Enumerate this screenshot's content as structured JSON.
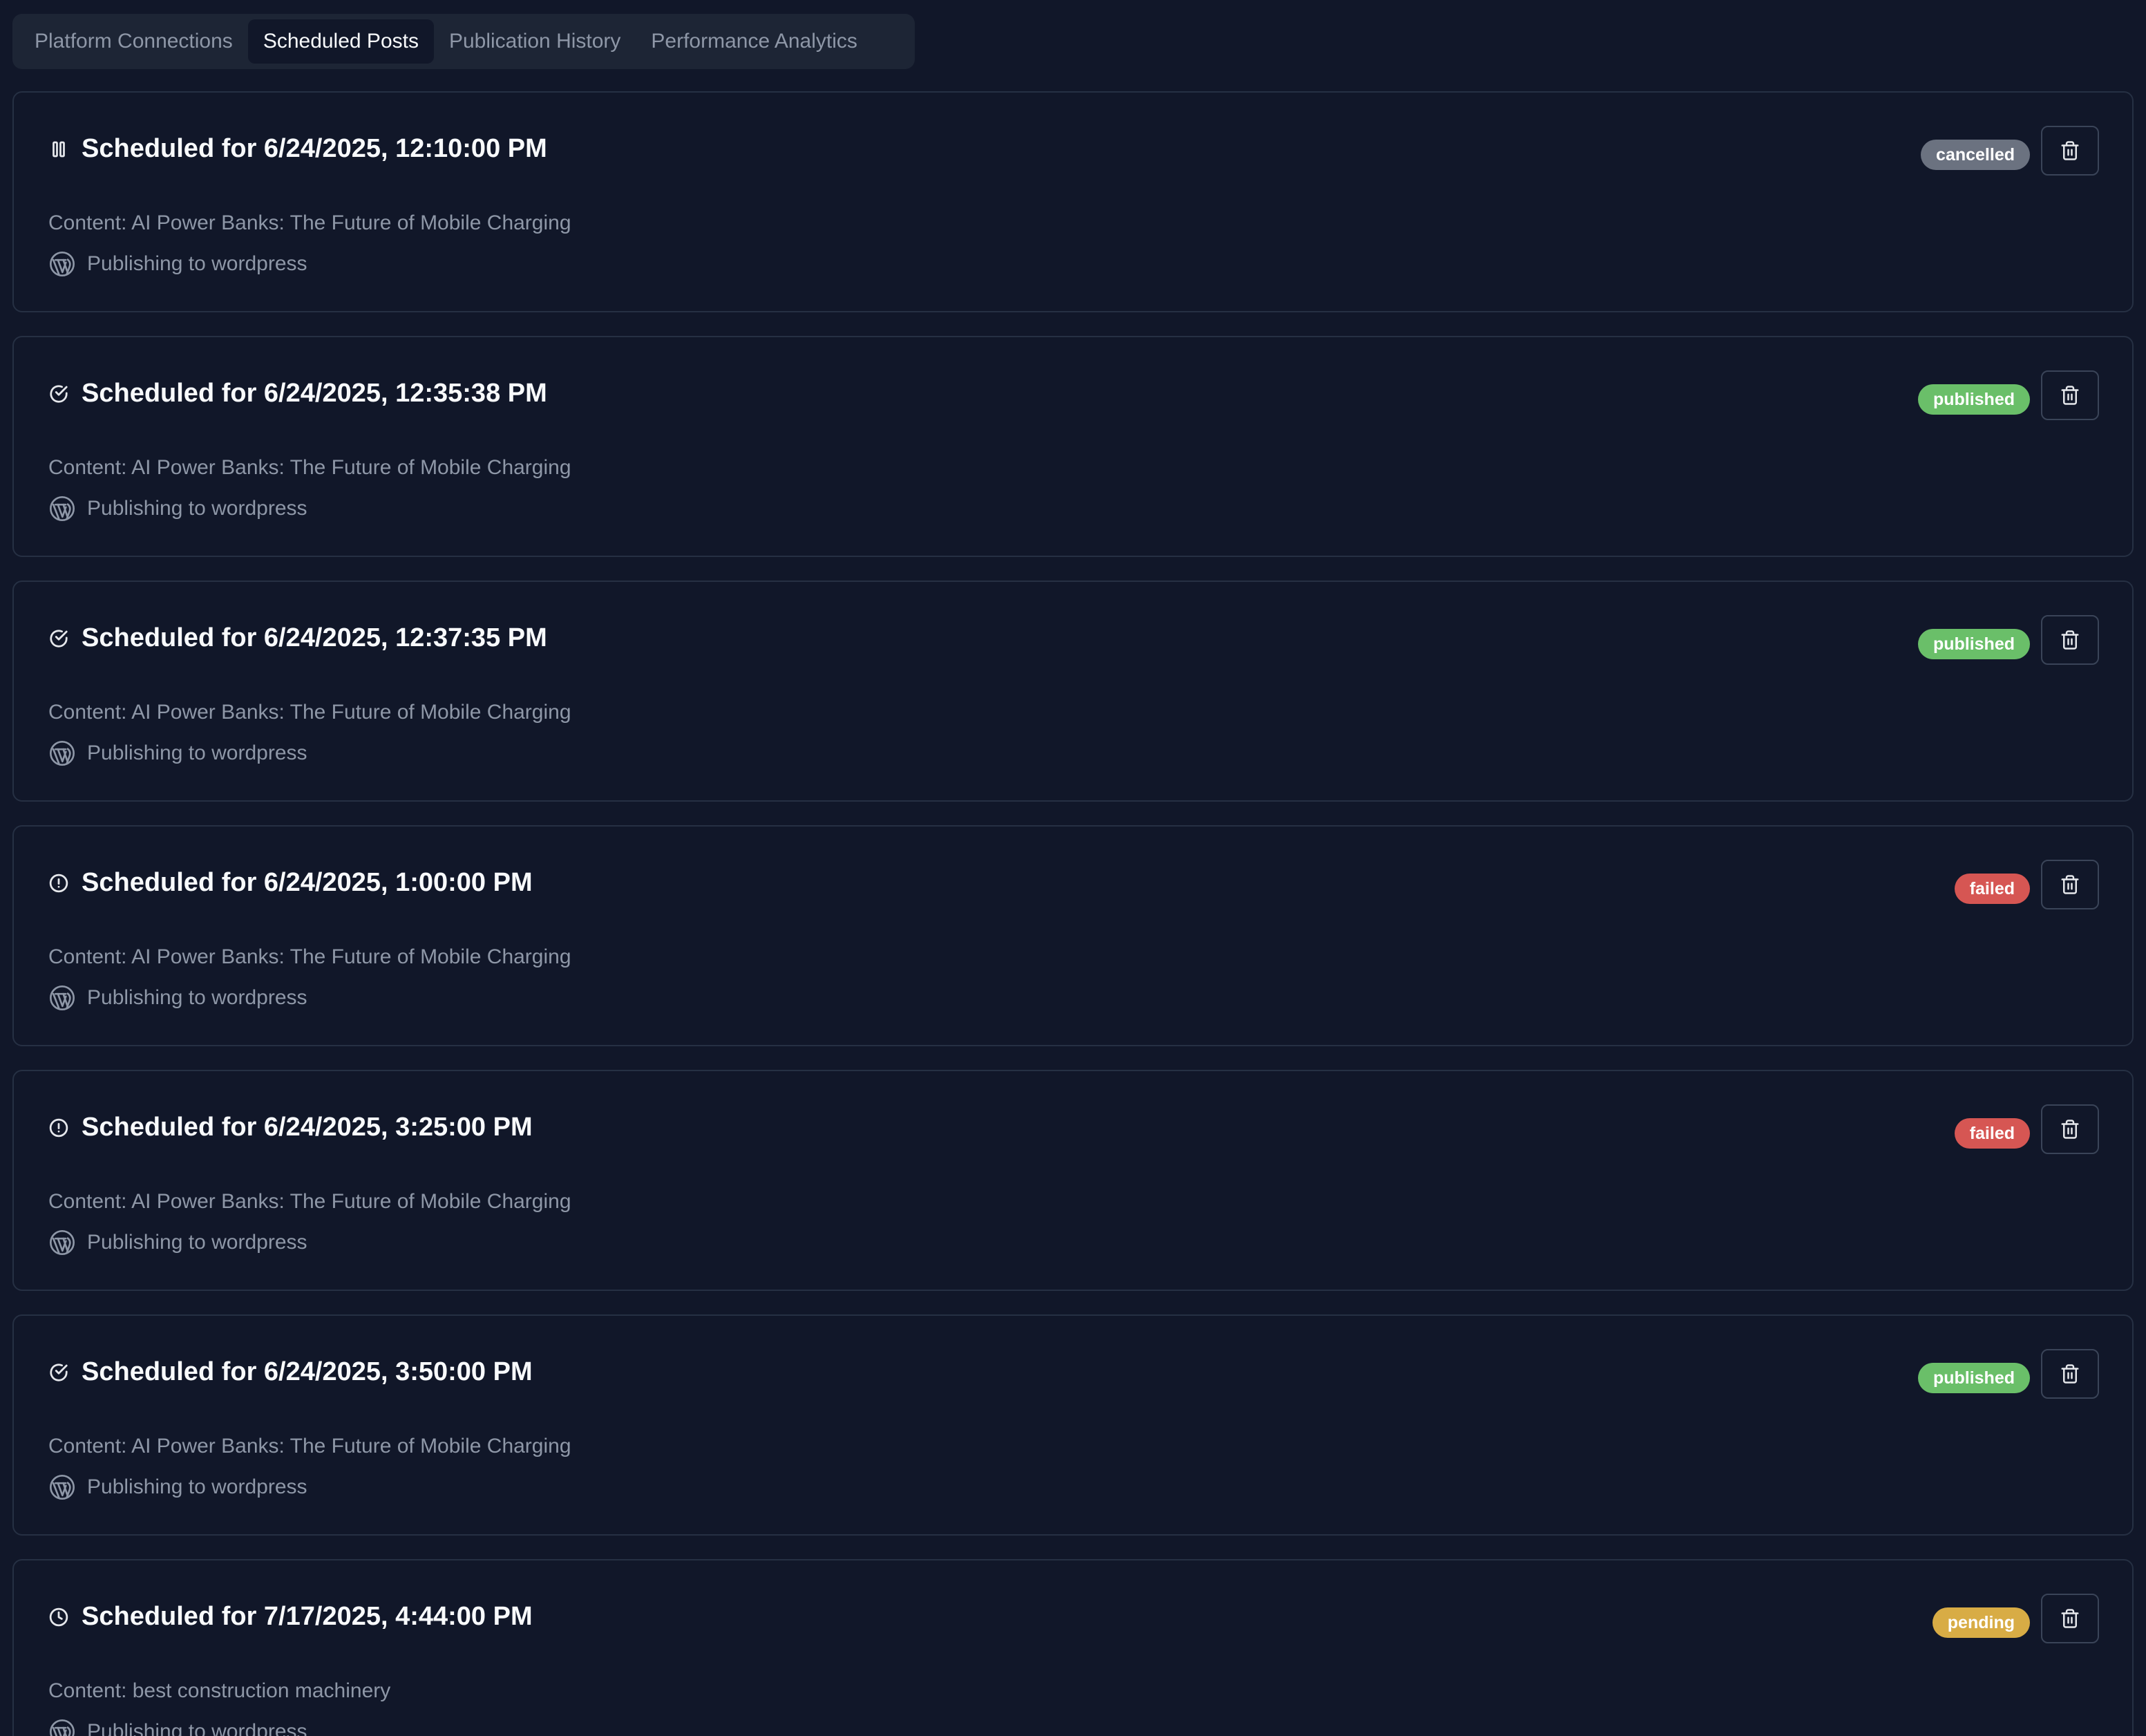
{
  "tabs": [
    {
      "label": "Platform Connections",
      "active": false
    },
    {
      "label": "Scheduled Posts",
      "active": true
    },
    {
      "label": "Publication History",
      "active": false
    },
    {
      "label": "Performance Analytics",
      "active": false
    }
  ],
  "status_colors": {
    "cancelled": "#6b7280",
    "published": "#6abf69",
    "failed": "#d65653",
    "pending": "#d8ac45"
  },
  "posts": [
    {
      "title": "Scheduled for 6/24/2025, 12:10:00 PM",
      "status": "cancelled",
      "status_icon": "pause-icon",
      "content": "Content: AI Power Banks: The Future of Mobile Charging",
      "platform": "Publishing to wordpress"
    },
    {
      "title": "Scheduled for 6/24/2025, 12:35:38 PM",
      "status": "published",
      "status_icon": "check-circle-icon",
      "content": "Content: AI Power Banks: The Future of Mobile Charging",
      "platform": "Publishing to wordpress"
    },
    {
      "title": "Scheduled for 6/24/2025, 12:37:35 PM",
      "status": "published",
      "status_icon": "check-circle-icon",
      "content": "Content: AI Power Banks: The Future of Mobile Charging",
      "platform": "Publishing to wordpress"
    },
    {
      "title": "Scheduled for 6/24/2025, 1:00:00 PM",
      "status": "failed",
      "status_icon": "alert-circle-icon",
      "content": "Content: AI Power Banks: The Future of Mobile Charging",
      "platform": "Publishing to wordpress"
    },
    {
      "title": "Scheduled for 6/24/2025, 3:25:00 PM",
      "status": "failed",
      "status_icon": "alert-circle-icon",
      "content": "Content: AI Power Banks: The Future of Mobile Charging",
      "platform": "Publishing to wordpress"
    },
    {
      "title": "Scheduled for 6/24/2025, 3:50:00 PM",
      "status": "published",
      "status_icon": "check-circle-icon",
      "content": "Content: AI Power Banks: The Future of Mobile Charging",
      "platform": "Publishing to wordpress"
    },
    {
      "title": "Scheduled for 7/17/2025, 4:44:00 PM",
      "status": "pending",
      "status_icon": "clock-icon",
      "content": "Content: best construction machinery",
      "platform": "Publishing to wordpress"
    }
  ]
}
